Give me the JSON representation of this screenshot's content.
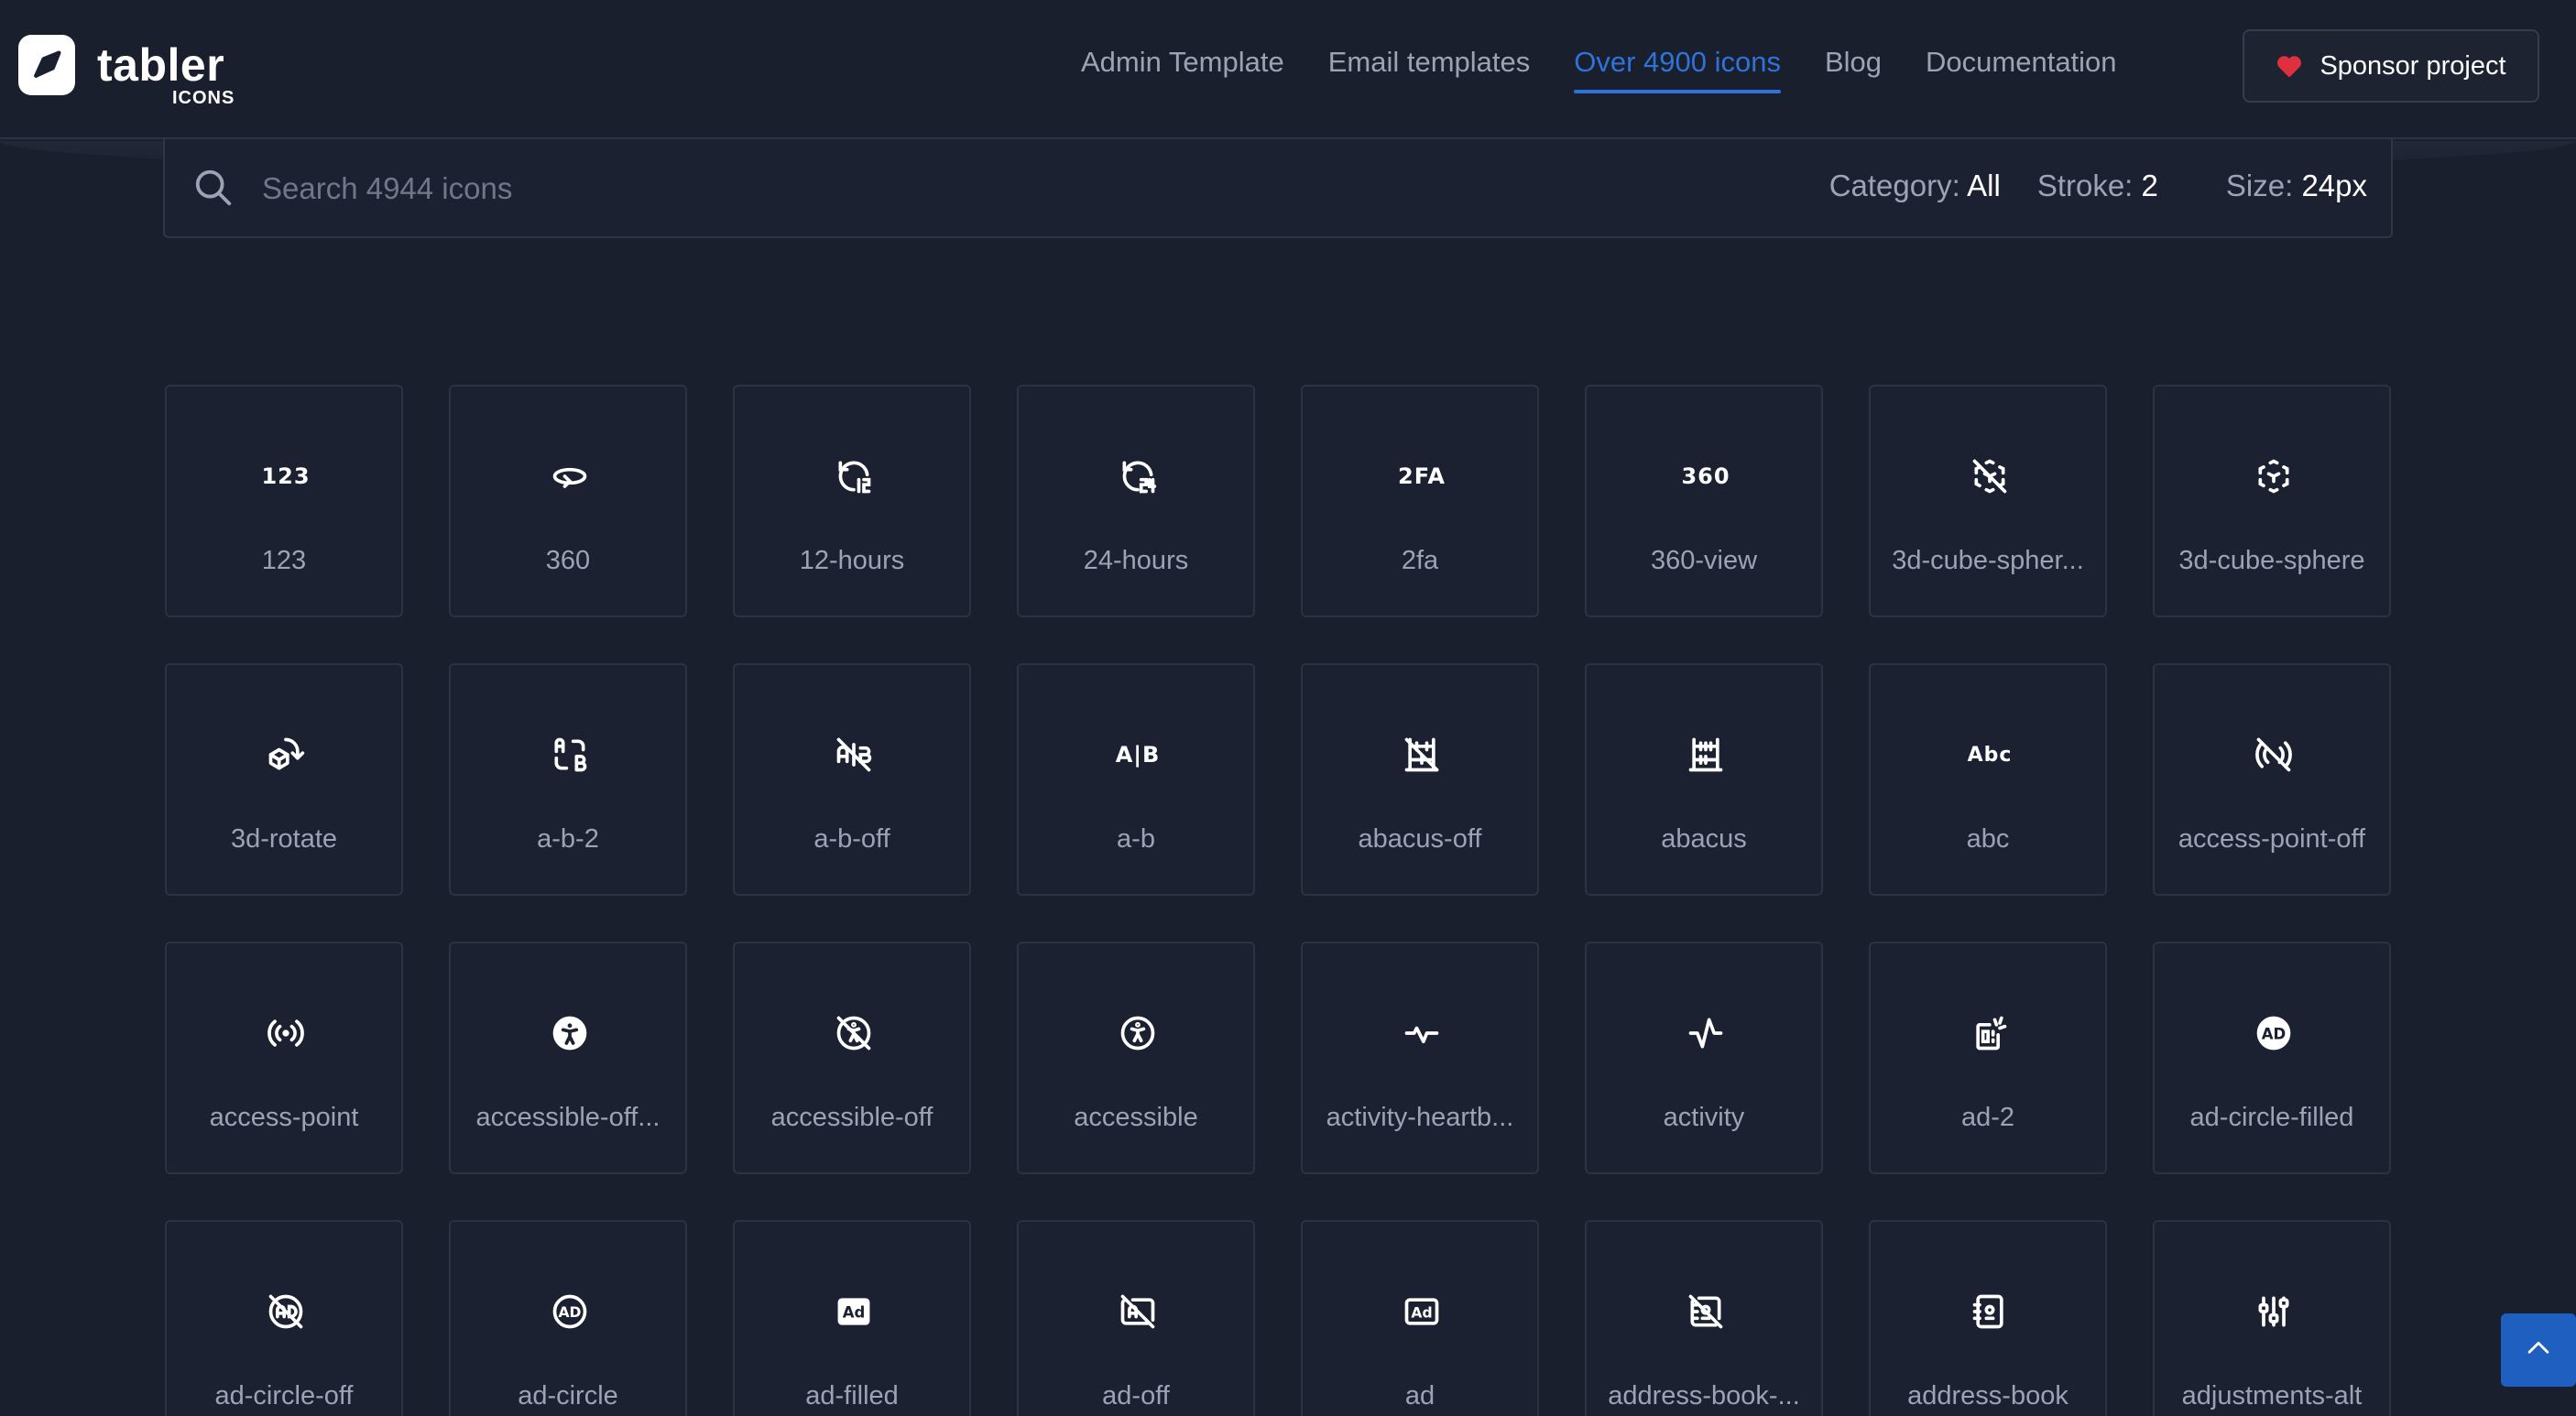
{
  "brand": {
    "name": "tabler",
    "sub": "ICONS"
  },
  "nav": [
    {
      "label": "Admin Template",
      "active": false
    },
    {
      "label": "Email templates",
      "active": false
    },
    {
      "label": "Over 4900 icons",
      "active": true
    },
    {
      "label": "Blog",
      "active": false
    },
    {
      "label": "Documentation",
      "active": false
    }
  ],
  "sponsor": {
    "label": "Sponsor project",
    "icon": "heart-icon",
    "color": "#e02f3f"
  },
  "search": {
    "placeholder": "Search 4944 icons",
    "category_label": "Category:",
    "category_value": "All",
    "stroke_label": "Stroke:",
    "stroke_value": "2",
    "size_label": "Size:",
    "size_value": "24px"
  },
  "accent": "#2f73d8",
  "icons": [
    {
      "label": "123",
      "glyph": "123"
    },
    {
      "label": "360",
      "icon": "360-icon"
    },
    {
      "label": "12-hours",
      "icon": "12-hours-icon"
    },
    {
      "label": "24-hours",
      "icon": "24-hours-icon"
    },
    {
      "label": "2fa",
      "glyph": "2FA"
    },
    {
      "label": "360-view",
      "glyph": "360"
    },
    {
      "label": "3d-cube-spher...",
      "icon": "3d-cube-sphere-off-icon"
    },
    {
      "label": "3d-cube-sphere",
      "icon": "3d-cube-sphere-icon"
    },
    {
      "label": "3d-rotate",
      "icon": "3d-rotate-icon"
    },
    {
      "label": "a-b-2",
      "icon": "a-b-2-icon"
    },
    {
      "label": "a-b-off",
      "glyph": "A/B"
    },
    {
      "label": "a-b",
      "glyph": "A|B"
    },
    {
      "label": "abacus-off",
      "icon": "abacus-off-icon"
    },
    {
      "label": "abacus",
      "icon": "abacus-icon"
    },
    {
      "label": "abc",
      "glyph": "Abc"
    },
    {
      "label": "access-point-off",
      "icon": "access-point-off-icon"
    },
    {
      "label": "access-point",
      "icon": "access-point-icon"
    },
    {
      "label": "accessible-off...",
      "icon": "accessible-off-filled-icon"
    },
    {
      "label": "accessible-off",
      "icon": "accessible-off-icon"
    },
    {
      "label": "accessible",
      "icon": "accessible-icon"
    },
    {
      "label": "activity-heartb...",
      "icon": "activity-heartbeat-icon"
    },
    {
      "label": "activity",
      "icon": "activity-icon"
    },
    {
      "label": "ad-2",
      "icon": "ad-2-icon"
    },
    {
      "label": "ad-circle-filled",
      "glyph": "AD"
    },
    {
      "label": "ad-circle-off",
      "icon": "ad-circle-off-icon"
    },
    {
      "label": "ad-circle",
      "glyph": "AD"
    },
    {
      "label": "ad-filled",
      "glyph": "Ad"
    },
    {
      "label": "ad-off",
      "icon": "ad-off-icon"
    },
    {
      "label": "ad",
      "glyph": "Ad"
    },
    {
      "label": "address-book-...",
      "icon": "address-book-off-icon"
    },
    {
      "label": "address-book",
      "icon": "address-book-icon"
    },
    {
      "label": "adjustments-alt",
      "icon": "adjustments-alt-icon"
    }
  ]
}
